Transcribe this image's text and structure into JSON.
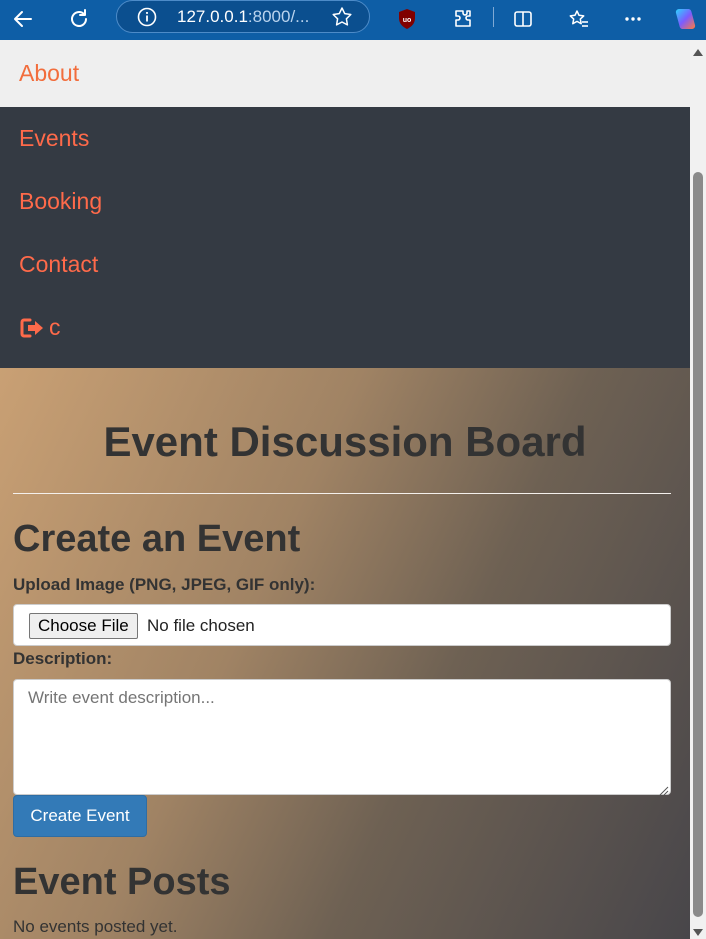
{
  "browser": {
    "url_host": "127.0.0.1",
    "url_rest": ":8000/..."
  },
  "menu": {
    "items": [
      {
        "label": "About"
      },
      {
        "label": "Events"
      },
      {
        "label": "Booking"
      },
      {
        "label": "Contact"
      },
      {
        "label": "c",
        "icon": "logout-icon"
      }
    ],
    "active_index": 0
  },
  "board": {
    "title": "Event Discussion Board"
  },
  "create_form": {
    "heading": "Create an Event",
    "upload_label": "Upload Image (PNG, JPEG, GIF only):",
    "choose_file_label": "Choose File",
    "no_file_text": "No file chosen",
    "description_label": "Description:",
    "description_placeholder": "Write event description...",
    "description_value": "",
    "submit_label": "Create Event"
  },
  "posts": {
    "heading": "Event Posts",
    "empty_text": "No events posted yet."
  },
  "colors": {
    "accent": "#ff6a4a",
    "menu_bg": "#343a43",
    "primary_button": "#337ab7",
    "browser_bar": "#0e5ea6"
  }
}
